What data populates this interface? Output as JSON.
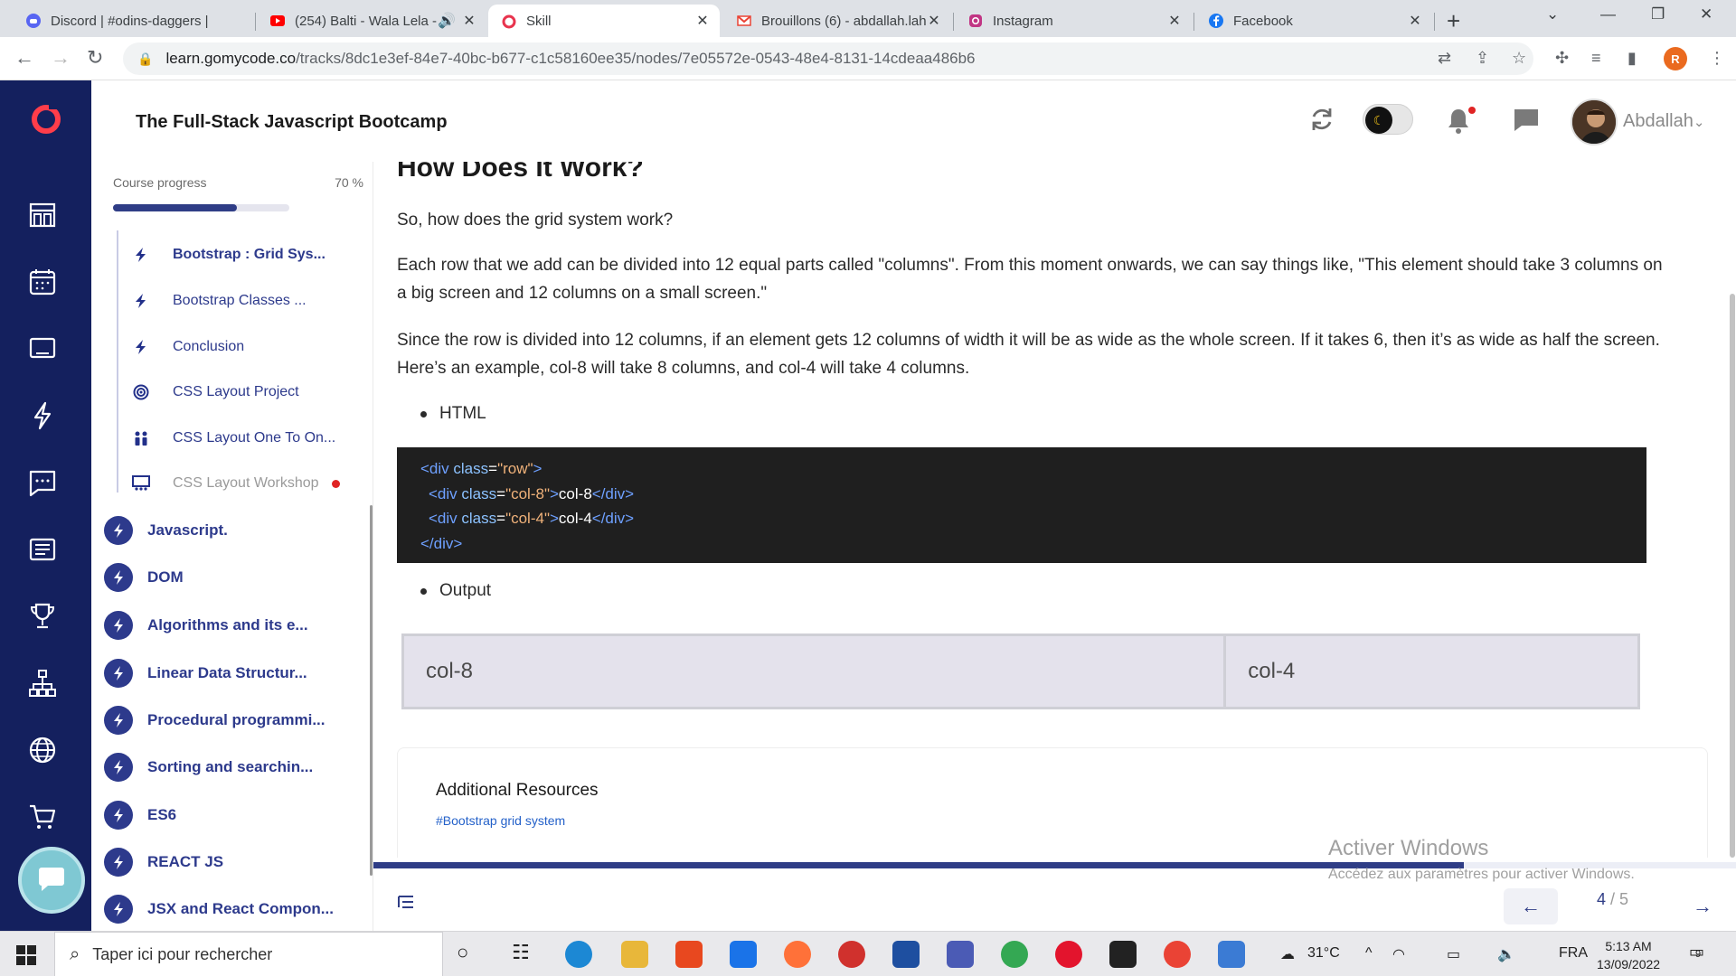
{
  "browser": {
    "tabs": [
      {
        "title": "Discord | #odins-daggers |",
        "icon": "discord-icon",
        "color": "#5865f2"
      },
      {
        "title": "(254) Balti - Wala Lela -",
        "icon": "youtube-icon",
        "color": "#ff0000"
      },
      {
        "title": "Skill",
        "icon": "gomycode-icon",
        "color": "#e8344e",
        "active": true
      },
      {
        "title": "Brouillons (6) - abdallah.lah",
        "icon": "gmail-icon",
        "color": "#ea4335"
      },
      {
        "title": "Instagram",
        "icon": "instagram-icon",
        "color": "#c13584"
      },
      {
        "title": "Facebook",
        "icon": "facebook-icon",
        "color": "#1877f2"
      }
    ],
    "url_domain": "learn.gomycode.co",
    "url_path": "/tracks/8dc1e3ef-84e7-40bc-b677-c1c58160ee35/nodes/7e05572e-0543-48e4-8131-14cdeaa486b6",
    "profile_initial": "R"
  },
  "header": {
    "course_title": "The Full-Stack Javascript Bootcamp",
    "username": "Abdallah"
  },
  "sidebar": {
    "progress_label": "Course progress",
    "progress_pct_text": "70 %",
    "progress_value": 0.7,
    "sub_items": [
      {
        "label": "Bootstrap : Grid Sys...",
        "icon": "bolt-icon",
        "current": true
      },
      {
        "label": "Bootstrap Classes ...",
        "icon": "bolt-icon"
      },
      {
        "label": "Conclusion",
        "icon": "bolt-icon"
      },
      {
        "label": "CSS Layout Project",
        "icon": "target-icon"
      },
      {
        "label": "CSS Layout One To On...",
        "icon": "people-icon"
      },
      {
        "label": "CSS Layout Workshop",
        "icon": "workshop-icon",
        "locked": true,
        "alert": true
      }
    ],
    "chapters": [
      {
        "label": "Javascript."
      },
      {
        "label": "DOM"
      },
      {
        "label": "Algorithms and its e..."
      },
      {
        "label": "Linear Data Structur..."
      },
      {
        "label": "Procedural programmi..."
      },
      {
        "label": "Sorting and searchin..."
      },
      {
        "label": "ES6"
      },
      {
        "label": "REACT JS"
      },
      {
        "label": "JSX and React Compon..."
      }
    ]
  },
  "content": {
    "heading": "How Does It Work?",
    "p1": "So, how does the grid system work?",
    "p2": "Each row that we add can be divided into 12 equal parts called \"columns\". From this moment onwards, we can say things like, \"This element should take 3 columns on a big screen and 12 columns on a small screen.\"",
    "p3": "Since the row is divided into 12 columns, if an element gets 12 columns of width it will be as wide as the whole screen. If it takes 6, then it’s as wide as half the screen. Here’s an example, col-8 will take 8 columns, and col-4 will take 4 columns.",
    "bullet_html": "HTML",
    "code": {
      "l1_open": "<div ",
      "l1_attr": "class",
      "l1_eq": "=",
      "l1_val": "\"row\"",
      "l1_close": ">",
      "l2_open": "<div ",
      "l2_attr": "class",
      "l2_eq": "=",
      "l2_val": "\"col-8\"",
      "l2_close": ">",
      "l2_text": "col-8",
      "l2_end": "</div>",
      "l3_open": "<div ",
      "l3_attr": "class",
      "l3_eq": "=",
      "l3_val": "\"col-4\"",
      "l3_close": ">",
      "l3_text": "col-4",
      "l3_end": "</div>",
      "l4_end": "</div>"
    },
    "bullet_output": "Output",
    "output_col8": "col-8",
    "output_col4": "col-4",
    "resources_title": "Additional Resources",
    "resources_link": "#Bootstrap grid system"
  },
  "lesson_nav": {
    "current": "4",
    "total": "/ 5",
    "progress_value": 0.8,
    "prev_icon": "←",
    "next_icon": "→"
  },
  "watermark": {
    "line1": "Activer Windows",
    "line2": "Accédez aux paramètres pour activer Windows."
  },
  "taskbar": {
    "search_placeholder": "Taper ici pour rechercher",
    "weather": "31°C",
    "lang": "FRA",
    "time": "5:13 AM",
    "date": "13/09/2022",
    "notif_count": "9"
  }
}
